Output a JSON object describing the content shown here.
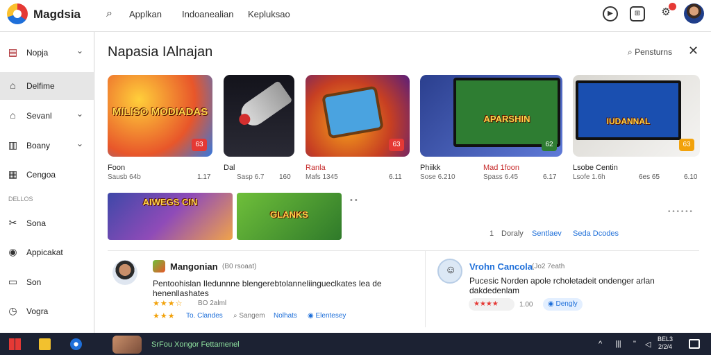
{
  "app": {
    "brand": "Magdsia"
  },
  "topbar": {
    "nav": [
      "Applkan",
      "Indoanealian",
      "Kepluksao"
    ],
    "icons": [
      "search-icon",
      "play-icon",
      "gamepad-icon",
      "notifications-icon",
      "avatar"
    ]
  },
  "sidebar": {
    "items": [
      {
        "label": "Nopja",
        "icon": "briefcase-icon",
        "chevron": "⌄"
      },
      {
        "label": "Delfime",
        "icon": "home-icon"
      },
      {
        "label": "Sevanl",
        "icon": "house-icon",
        "chevron": "⌄"
      },
      {
        "label": "Boany",
        "icon": "book-icon",
        "chevron": "⌄"
      },
      {
        "label": "Cengoa",
        "icon": "chart-icon"
      },
      {
        "label": "Sona",
        "icon": "tools-icon"
      },
      {
        "label": "Appicakat",
        "icon": "pin-icon"
      },
      {
        "label": "Son",
        "icon": "monitor-icon"
      },
      {
        "label": "Vogra",
        "icon": "clock-icon"
      }
    ],
    "section": "DELLOS"
  },
  "main": {
    "title": "Napasia IAlnajan",
    "actions_label": "Pensturns",
    "close": "✕",
    "cards": [
      {
        "title": "MILISO MODIADAS",
        "tag": "63",
        "name": "Foon",
        "meta": "Sausb 64b",
        "num": "1.17"
      },
      {
        "title": "",
        "tag": "",
        "name": "Dal",
        "meta": "Sasp 6.7",
        "num": "160"
      },
      {
        "title": "",
        "tag": "63",
        "name": "Ranla",
        "meta": "Mafs 1345",
        "num": "6.11"
      },
      {
        "title": "APARSHIN",
        "tag": "62",
        "name": "Phiikk",
        "meta": "Sose 6.210",
        "num": "",
        "name2": "Mad 1foon",
        "meta2": "Spass 6.45",
        "num2": "6.17"
      },
      {
        "title": "IUDANNAL",
        "tag": "63",
        "name": "Lsobe Centin",
        "meta": "Lsofe 1.6h",
        "num": "6es 65",
        "num2": "6.10"
      }
    ],
    "banners": [
      {
        "title": "AIWEGS CIN"
      },
      {
        "title": "GLANKS"
      }
    ],
    "pagination_dots": "• •",
    "more": "• • • • • •",
    "controls": {
      "page": "1",
      "display": "Doraly",
      "sort": "Sentlaev",
      "filter": "Seda Dcodes"
    }
  },
  "reviews": [
    {
      "name": "Mangonian",
      "sub": "(B0 rsoaat)",
      "text": "Pentoohislan Iledunnne blengerebtolanneliingueclkates lea de henenllashates",
      "rating": "BO 2alml",
      "tags": [
        "To. Clandes",
        "Sangem",
        "Nolhats",
        "Elentesey"
      ]
    },
    {
      "name": "Vrohn Cancola",
      "sub": "(Jo2 7eath",
      "text": "Pucesic Norden apole rcholetadeit ondenger arlan dakdedenlam",
      "rating": "1.00",
      "pill": "Dengly"
    }
  ],
  "taskbar": {
    "app_text": "SrFou Xongor Fettamenel",
    "sys": [
      "^",
      "|||",
      "\"",
      "◁"
    ],
    "clock": "BEL3\n2/2/4"
  },
  "colors": {
    "accent": "#1e6fd9",
    "danger": "#e53935",
    "star": "#f2a20b",
    "taskbar": "#1c2233"
  }
}
